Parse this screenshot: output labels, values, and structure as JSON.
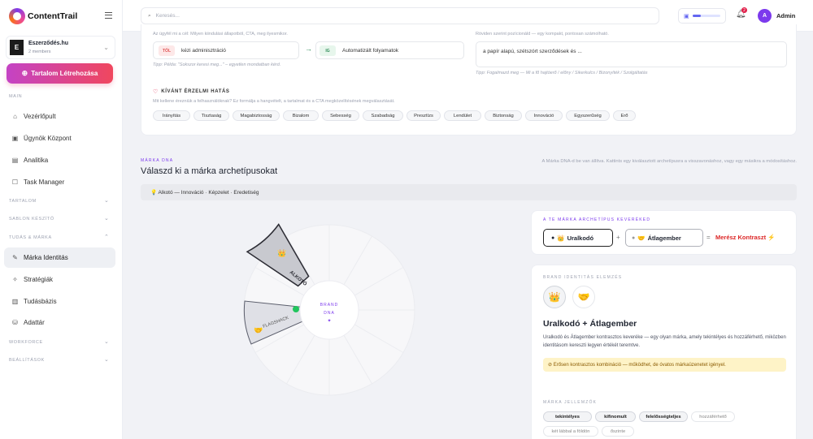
{
  "app": {
    "logo_text": "ContentTrail"
  },
  "workspace": {
    "avatar_letter": "E",
    "name": "Eszerződés.hu",
    "members": "2 members"
  },
  "create_button": {
    "label": "Tartalom Létrehozása"
  },
  "sidebar": {
    "main_label": "MAIN",
    "main_items": [
      {
        "label": "Vezérlőpult",
        "icon": "home-icon"
      },
      {
        "label": "Ügynök Központ",
        "icon": "agent-icon"
      },
      {
        "label": "Analitika",
        "icon": "analytics-icon"
      },
      {
        "label": "Task Manager",
        "icon": "task-icon"
      }
    ],
    "section_tartalom": "TARTALOM",
    "section_sablon": "SABLON KÉSZÍTŐ",
    "section_tudas": "TUDÁS & MÁRKA",
    "tudas_items": [
      {
        "label": "Márka Identitás",
        "icon": "brand-icon"
      },
      {
        "label": "Stratégiák",
        "icon": "strategy-icon"
      },
      {
        "label": "Tudásbázis",
        "icon": "book-icon"
      },
      {
        "label": "Adattár",
        "icon": "database-icon"
      }
    ],
    "section_workforce": "WORKFORCE",
    "section_beallitasok": "BEÁLLÍTÁSOK"
  },
  "topbar": {
    "search_placeholder": "Keresés...",
    "notif_count": "2",
    "user_initial": "A",
    "user_name": "Admin"
  },
  "top_card": {
    "faded_left": "Az ügyfél mi a cél: Milyen kiindulási állapotból, CTA, meg ilyesmikor.",
    "from_tag": "TÓL",
    "from_text": "kézi adminisztráció",
    "to_tag": "IG",
    "to_text": "Automatizált folyamatok",
    "left_hint": "Tipp: Példa: \"Sokszor keresi meg...\" – egyetlen mondatban kérd.",
    "faded_right": "Röviden szerint pozícionáld — egy kompakt, pontosan számolható.",
    "right_value": "a papír alapú, szétszórt szerződések és ...",
    "right_hint": "Tipp: Fogalmazd meg — Mi a fő hajtóerő / előny / Sikerkulcs / Bizonyíték / Szolgáltatás",
    "emotion_title": "KÍVÁNT ÉRZELMI HATÁS",
    "emotion_sub": "Mit kellene érezniük a felhasználóknak? Ez formálja a hangvételt, a tartalmat és a CTA megközelítésének megválasztását.",
    "emotion_chips": [
      "Irányítás",
      "Tisztaság",
      "Magabiztosság",
      "Bizalom",
      "Sebesség",
      "Szabadság",
      "Presztízs",
      "Lendület",
      "Biztonság",
      "Innováció",
      "Egyszerűség",
      "Erő"
    ]
  },
  "archetype_section": {
    "kicker": "MÁRKA DNA",
    "title": "Válaszd ki a márka archetípusokat",
    "note": "A Márka DNA-d be van állítva. Kattints egy kiválasztott archetípusra a visszavonáshoz, vagy egy másikra a módosításhoz.",
    "tip_bar": "💡 Alkotó — Innováció · Képzelet · Eredetiség"
  },
  "wheel": {
    "center_line1": "BRAND",
    "center_line2": "DNA",
    "selected_1": "ALKOTÓ",
    "selected_2": "FLAGSHACK",
    "selected_1_icon": "crown-icon",
    "selected_2_icon": "handshake-icon"
  },
  "combo": {
    "kicker": "A TE MÁRKA ARCHETÍPUS KEVERÉKED",
    "first": "Uralkodó",
    "plus": "+",
    "second": "Átlagember",
    "equals": "=",
    "result": "Merész Kontraszt ⚡"
  },
  "identity": {
    "kicker": "BRAND IDENTITÁS ELEMZÉS",
    "title": "Uralkodó + Átlagember",
    "desc": "Uralkodó és Átlagember kontrasztos keveréke — egy olyan márka, amely tekintélyes és hozzáférhető, miközben identitásom kereszti legyen értékét teremtve.",
    "warning": "⊘ Erősen kontrasztos kombináció — működhet, de óvatos márkaüzenetet igényel.",
    "traits_kicker": "MÁRKA JELLEMZŐK",
    "traits": [
      {
        "label": "tekintélyes",
        "active": true
      },
      {
        "label": "kifinomult",
        "active": true
      },
      {
        "label": "felelősségteljes",
        "active": true
      },
      {
        "label": "hozzáférhető",
        "active": false
      },
      {
        "label": "két lábbal a földön",
        "active": false
      },
      {
        "label": "őszinte",
        "active": false
      }
    ]
  },
  "colors": {
    "accent": "#7c3aed",
    "brand_gradient_start": "#c443c5",
    "brand_gradient_end": "#f0475e",
    "warning_bg": "#fef3c7",
    "result_red": "#dc2626"
  }
}
